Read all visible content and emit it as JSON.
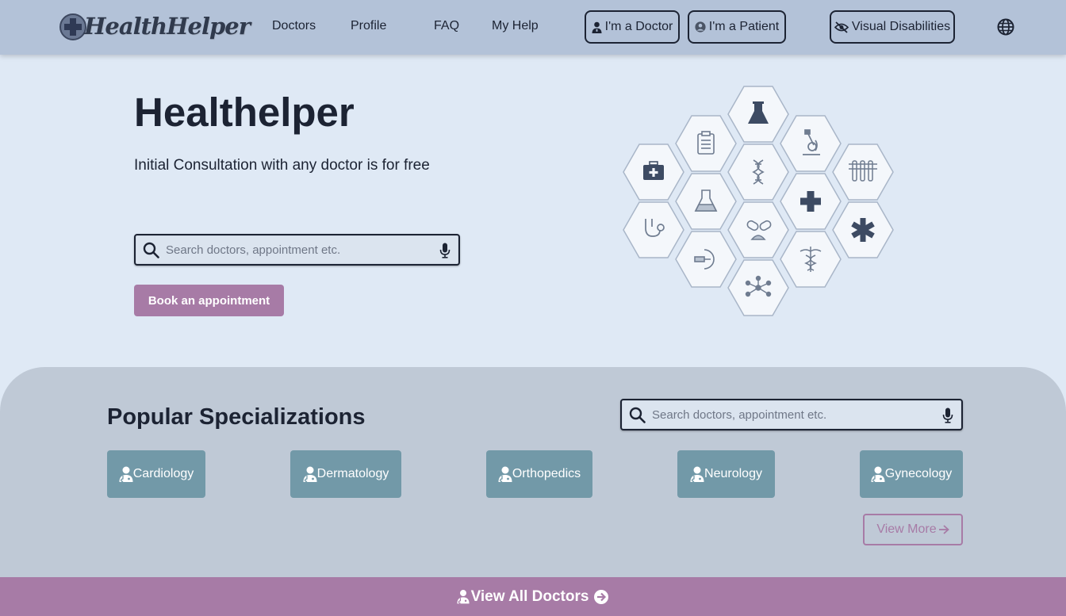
{
  "header": {
    "logo_text": "HealthHelper",
    "nav": [
      "Doctors",
      "Profile",
      "FAQ",
      "My Help"
    ],
    "doctor_btn": "I'm a Doctor",
    "patient_btn": "I'm a Patient",
    "accessibility_btn": "Visual Disabilities"
  },
  "hero": {
    "title": "Healthelper",
    "subtitle": "Initial Consultation with any doctor is for free",
    "search_placeholder": "Search doctors, appointment etc.",
    "book_button": "Book an appointment"
  },
  "specializations": {
    "title": "Popular Specializations",
    "search_placeholder": "Search doctors, appointment etc.",
    "items": [
      "Cardiology",
      "Dermatology",
      "Orthopedics",
      "Neurology",
      "Gynecology"
    ],
    "view_more": "View More"
  },
  "footer_bar": {
    "label": "View All Doctors"
  },
  "colors": {
    "header_bg": "#b3c2d8",
    "page_bg": "#dfe9f5",
    "accent_purple": "#a77ba6",
    "spec_button": "#7299a8",
    "section_bg": "#bfc9d6",
    "text_dark": "#1c2333"
  },
  "hex_icons": [
    "flask-icon",
    "clipboard-icon",
    "microscope-icon",
    "first-aid-kit-icon",
    "dna-icon",
    "test-tubes-icon",
    "beaker-icon",
    "medical-cross-icon",
    "stethoscope-icon",
    "pills-icon",
    "star-of-life-icon",
    "x-ray-scanner-icon",
    "caduceus-icon",
    "molecule-icon"
  ]
}
